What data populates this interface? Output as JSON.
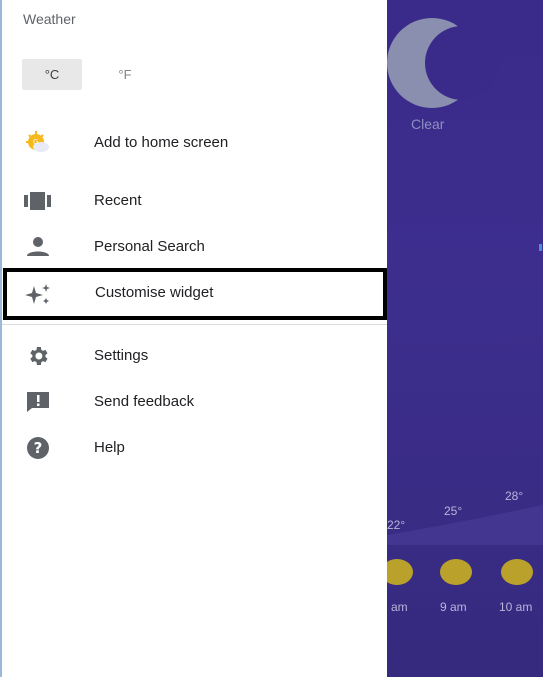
{
  "drawer": {
    "title": "Weather",
    "units": [
      {
        "label": "°C",
        "selected": true
      },
      {
        "label": "°F",
        "selected": false
      }
    ],
    "items": [
      {
        "label": "Add to home screen",
        "icon": "weather-sun-icon"
      },
      {
        "label": "Recent",
        "icon": "recent-cards-icon"
      },
      {
        "label": "Personal Search",
        "icon": "person-icon"
      },
      {
        "label": "Customise widget",
        "icon": "sparkle-icon"
      },
      {
        "label": "Settings",
        "icon": "gear-icon"
      },
      {
        "label": "Send feedback",
        "icon": "feedback-icon"
      },
      {
        "label": "Help",
        "icon": "help-icon"
      }
    ]
  },
  "weather_bg": {
    "condition": "Clear",
    "temps": [
      "22°",
      "25°",
      "28°"
    ],
    "hours": [
      "am",
      "9 am",
      "10 am"
    ]
  }
}
